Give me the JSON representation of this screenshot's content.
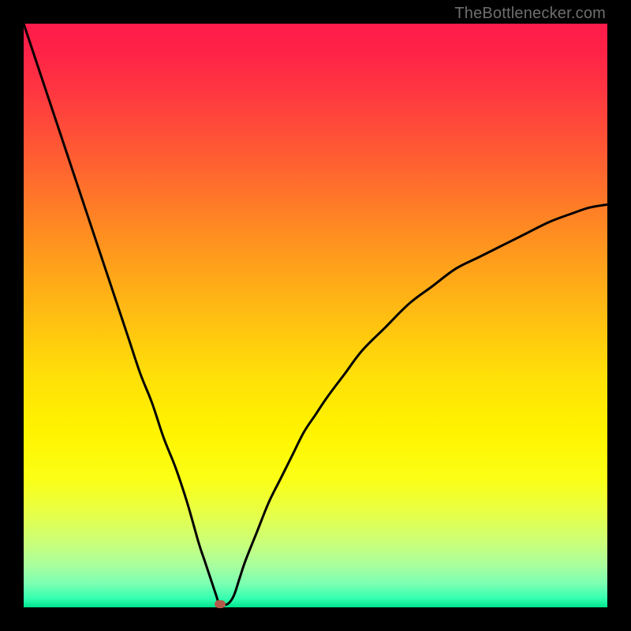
{
  "watermark": {
    "text": "TheBottlenecker.com"
  },
  "gradient": {
    "stops": [
      {
        "offset": 0.0,
        "color": "#ff1b4a"
      },
      {
        "offset": 0.05,
        "color": "#ff2347"
      },
      {
        "offset": 0.12,
        "color": "#ff3840"
      },
      {
        "offset": 0.22,
        "color": "#ff5a33"
      },
      {
        "offset": 0.35,
        "color": "#ff8a22"
      },
      {
        "offset": 0.48,
        "color": "#ffb714"
      },
      {
        "offset": 0.6,
        "color": "#ffdf08"
      },
      {
        "offset": 0.7,
        "color": "#fff400"
      },
      {
        "offset": 0.78,
        "color": "#fbff16"
      },
      {
        "offset": 0.84,
        "color": "#e6ff48"
      },
      {
        "offset": 0.89,
        "color": "#c9ff7a"
      },
      {
        "offset": 0.93,
        "color": "#a7ff9f"
      },
      {
        "offset": 0.96,
        "color": "#7affb3"
      },
      {
        "offset": 0.985,
        "color": "#33ffb0"
      },
      {
        "offset": 1.0,
        "color": "#00e38c"
      }
    ]
  },
  "chart_data": {
    "type": "line",
    "title": "",
    "xlabel": "",
    "ylabel": "",
    "xlim": [
      0,
      100
    ],
    "ylim": [
      0,
      100
    ],
    "x": [
      0,
      2,
      4,
      6,
      8,
      10,
      12,
      14,
      16,
      18,
      20,
      22,
      24,
      26,
      28,
      30,
      31,
      32,
      33,
      33.5,
      34,
      35,
      36,
      37,
      38,
      40,
      42,
      44,
      46,
      48,
      50,
      52,
      55,
      58,
      62,
      66,
      70,
      74,
      78,
      82,
      86,
      90,
      94,
      97,
      100
    ],
    "values": [
      100,
      94,
      88,
      82,
      76,
      70,
      64,
      58,
      52,
      46,
      40,
      35,
      29,
      24,
      18,
      11,
      8,
      5,
      2,
      0.5,
      0.5,
      0.6,
      2,
      5,
      8,
      13,
      18,
      22,
      26,
      30,
      33,
      36,
      40,
      44,
      48,
      52,
      55,
      58,
      60,
      62,
      64,
      66,
      67.5,
      68.5,
      69
    ],
    "annotations": [
      {
        "type": "marker",
        "x": 33.6,
        "y": 0.5,
        "shape": "rounded-rect",
        "color": "#b35a4a"
      }
    ],
    "grid": false,
    "legend": false
  }
}
